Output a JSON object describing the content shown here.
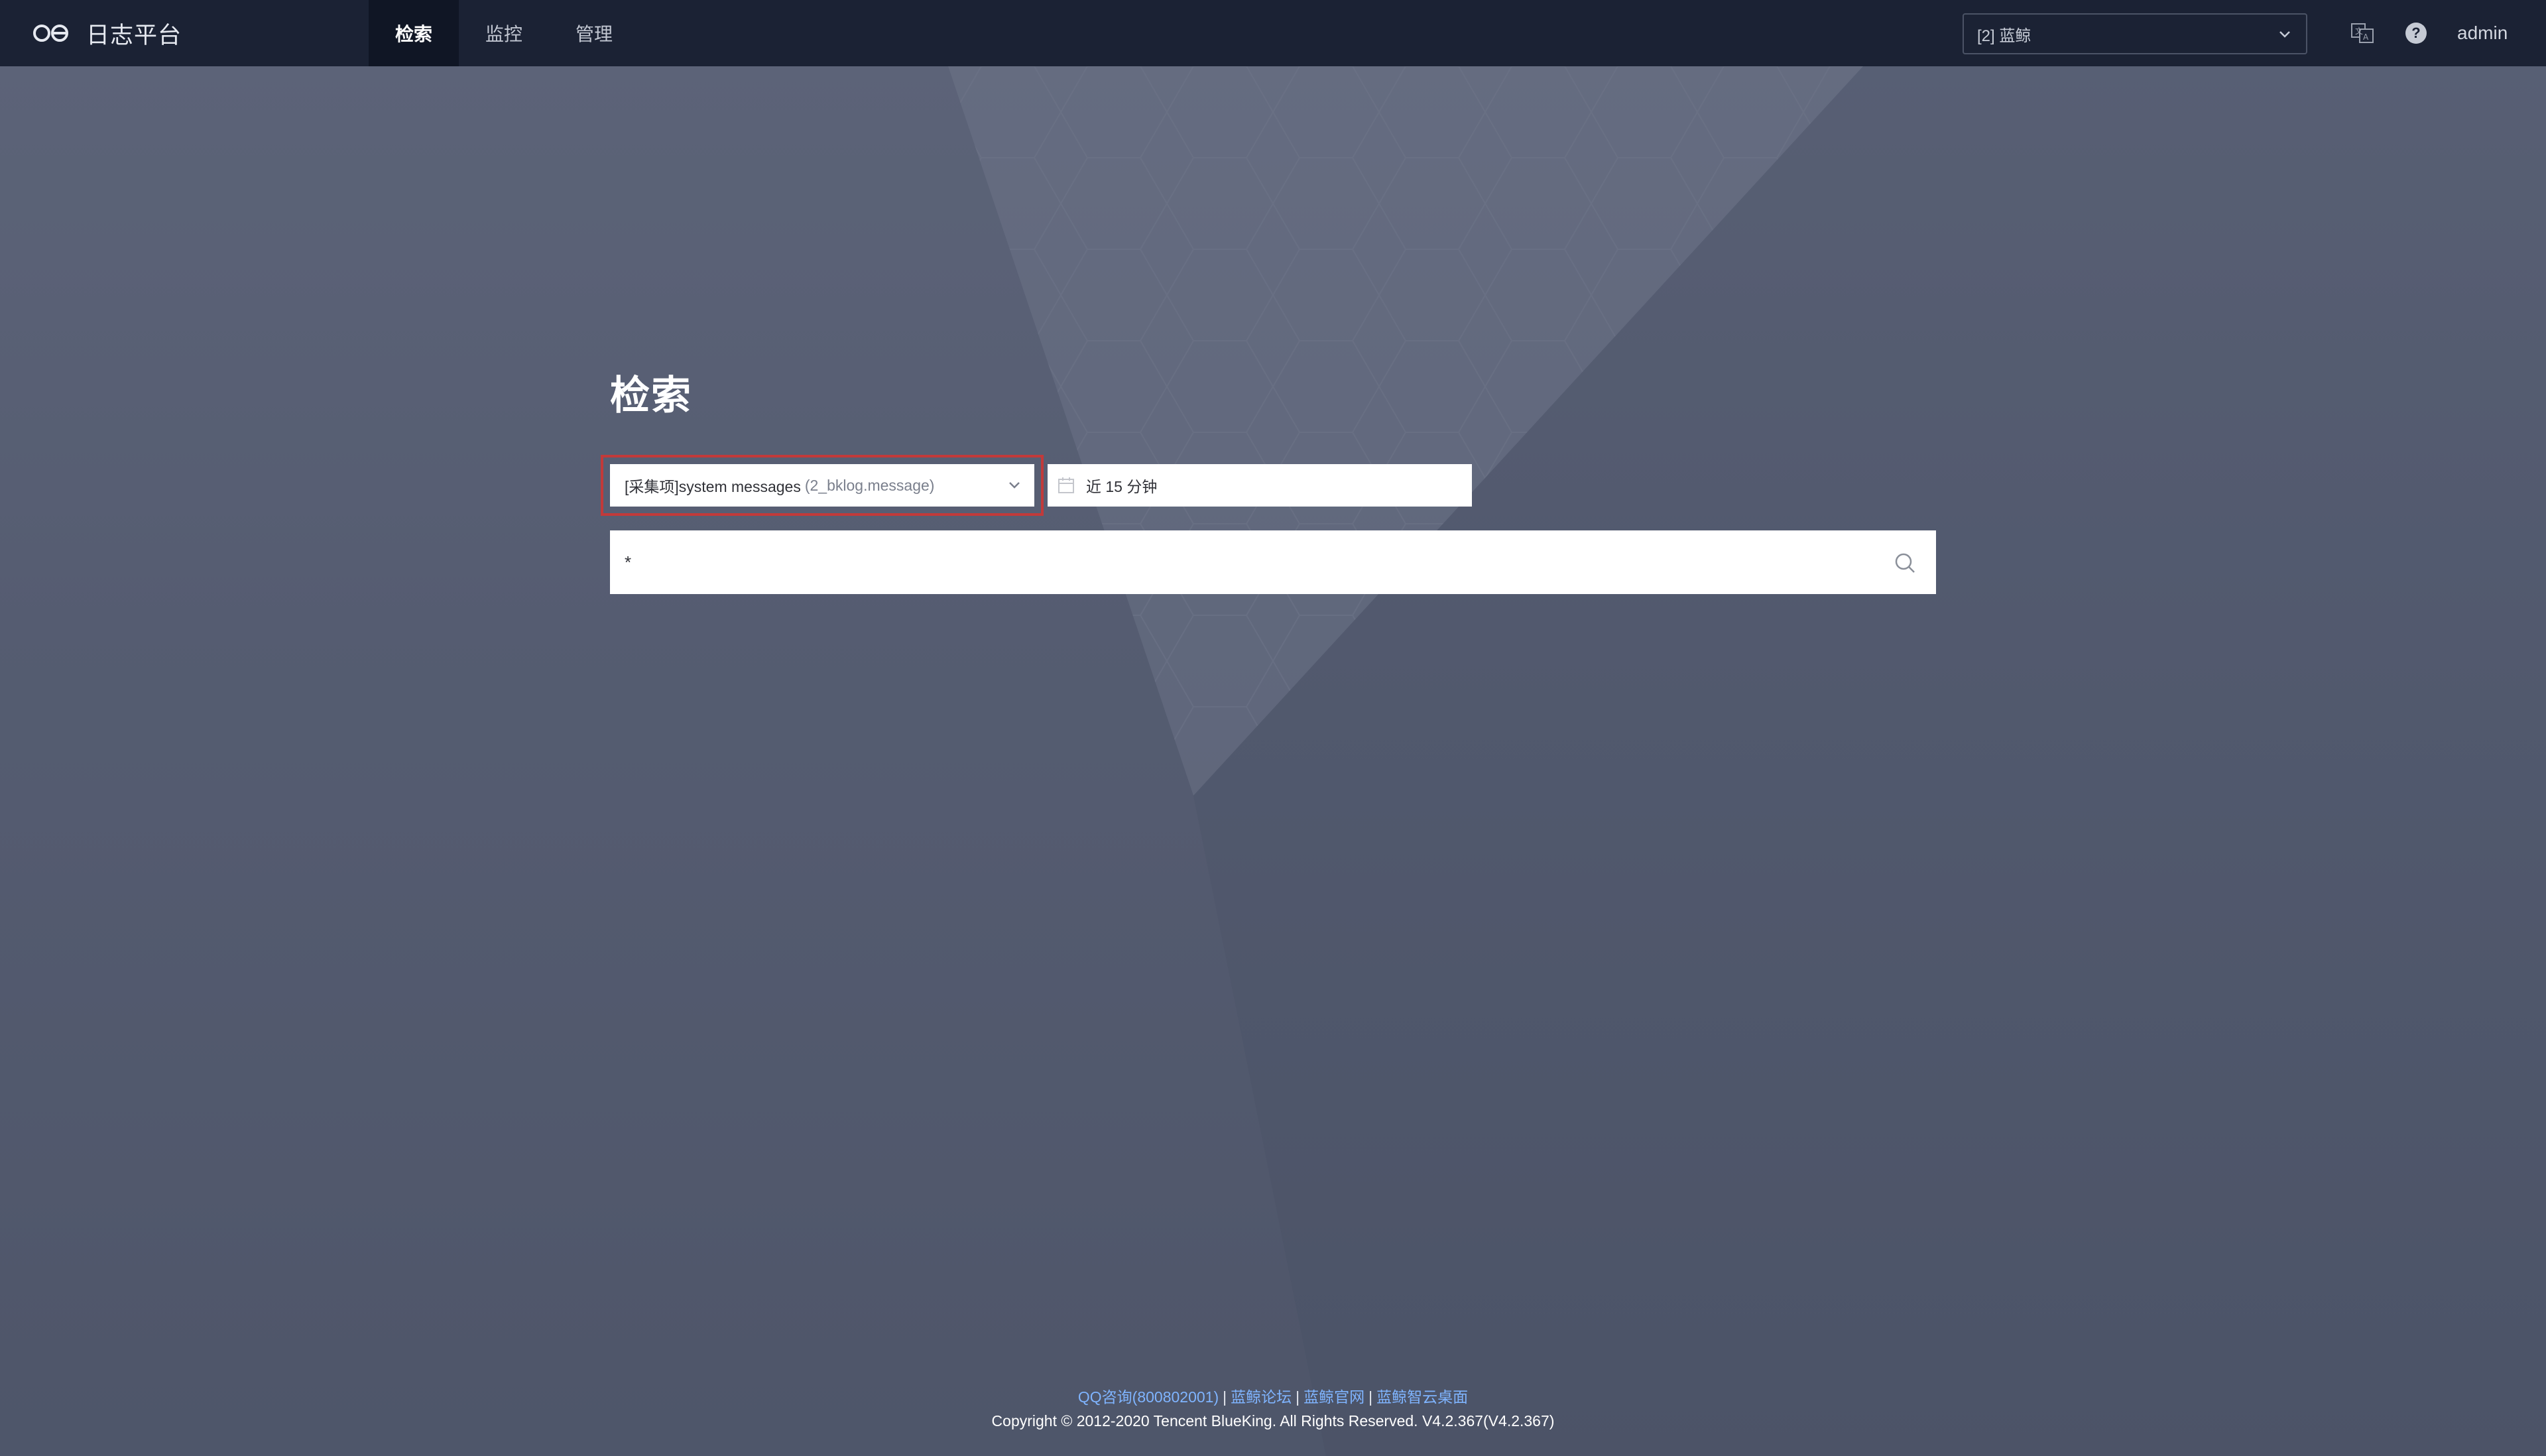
{
  "header": {
    "brand_name": "日志平台",
    "nav": [
      {
        "label": "检索",
        "active": true
      },
      {
        "label": "监控",
        "active": false
      },
      {
        "label": "管理",
        "active": false
      }
    ],
    "business_select": "[2] 蓝鲸",
    "user": "admin"
  },
  "search": {
    "title": "检索",
    "index_set": {
      "label": "[采集项]system messages",
      "sub": "(2_bklog.message)"
    },
    "time_range": "近 15 分钟",
    "query_value": "*"
  },
  "footer": {
    "links": [
      "QQ咨询(800802001)",
      "蓝鲸论坛",
      "蓝鲸官网",
      "蓝鲸智云桌面"
    ],
    "separator": "|",
    "copyright": "Copyright © 2012-2020 Tencent BlueKing. All Rights Reserved. V4.2.367(V4.2.367)"
  },
  "colors": {
    "topbar": "#1b2234",
    "nav_active": "#101625",
    "background": "#565d72",
    "highlight_border": "#c23a3a",
    "link": "#7fb4ff"
  },
  "icons": [
    "brand-logo-icon",
    "chevron-down-icon",
    "translate-icon",
    "help-icon",
    "calendar-icon",
    "search-icon"
  ]
}
